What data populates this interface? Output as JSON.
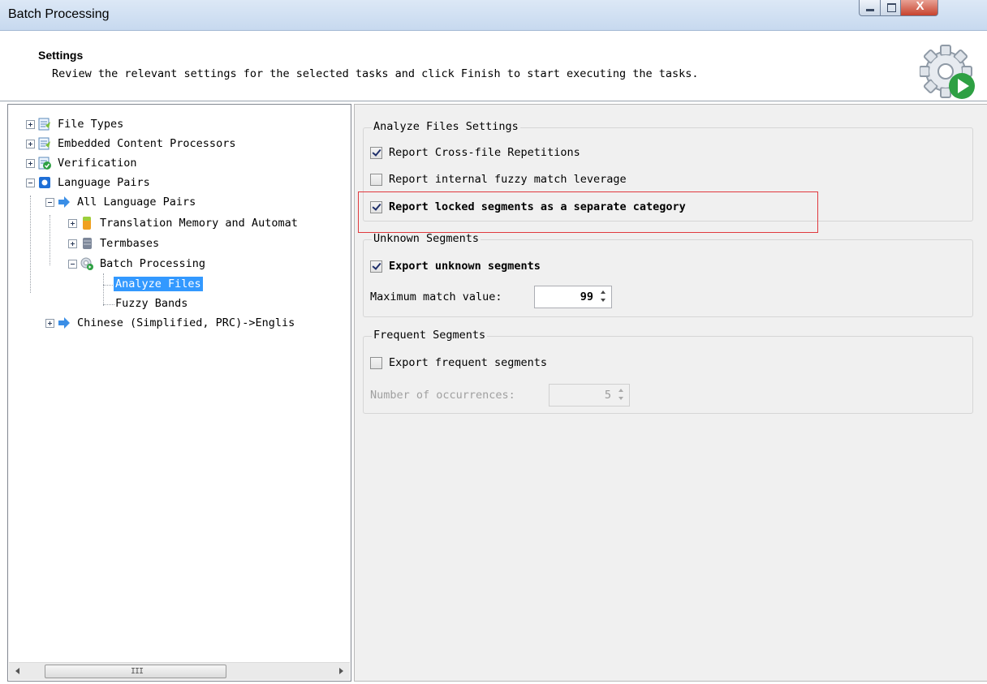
{
  "window": {
    "title": "Batch Processing",
    "controls": {
      "close_label": "X"
    }
  },
  "header": {
    "title": "Settings",
    "description": "Review the relevant settings for the selected tasks and click Finish to start executing the tasks.",
    "icon": "gear-play-icon"
  },
  "tree": {
    "items": [
      {
        "label": "File Types",
        "icon": "file-types-icon",
        "expander": "plus"
      },
      {
        "label": "Embedded Content Processors",
        "icon": "embedded-content-icon",
        "expander": "plus"
      },
      {
        "label": "Verification",
        "icon": "verification-icon",
        "expander": "plus"
      },
      {
        "label": "Language Pairs",
        "icon": "language-pairs-icon",
        "expander": "minus"
      },
      {
        "label": "All Language Pairs",
        "icon": "arrow-right-icon",
        "expander": "minus"
      },
      {
        "label": "Translation Memory and Automat",
        "icon": "translation-memory-icon",
        "expander": "plus"
      },
      {
        "label": "Termbases",
        "icon": "termbase-icon",
        "expander": "plus"
      },
      {
        "label": "Batch Processing",
        "icon": "batch-processing-icon",
        "expander": "minus"
      },
      {
        "label": "Analyze Files",
        "selected": true
      },
      {
        "label": "Fuzzy Bands"
      },
      {
        "label": "Chinese (Simplified, PRC)->Englis",
        "icon": "arrow-right-icon",
        "expander": "plus"
      }
    ],
    "scrollbar": {
      "grip": "III"
    }
  },
  "analyze_files": {
    "title": "Analyze Files Settings",
    "report_cross_file": {
      "label": "Report Cross-file Repetitions",
      "checked": true
    },
    "report_internal_fuzzy": {
      "label": "Report internal fuzzy match leverage",
      "checked": false
    },
    "report_locked": {
      "label": "Report locked segments as a separate category",
      "checked": true
    }
  },
  "unknown_segments": {
    "title": "Unknown Segments",
    "export_unknown": {
      "label": "Export unknown segments",
      "checked": true
    },
    "max_match_label": "Maximum match value:",
    "max_match_value": "99"
  },
  "frequent_segments": {
    "title": "Frequent Segments",
    "export_frequent": {
      "label": "Export frequent segments",
      "checked": false
    },
    "occurrences_label": "Number of occurrences:",
    "occurrences_value": "5"
  },
  "colors": {
    "selection": "#3399ff",
    "highlight_border": "#e0393e",
    "panel_bg": "#f0f0f0"
  }
}
